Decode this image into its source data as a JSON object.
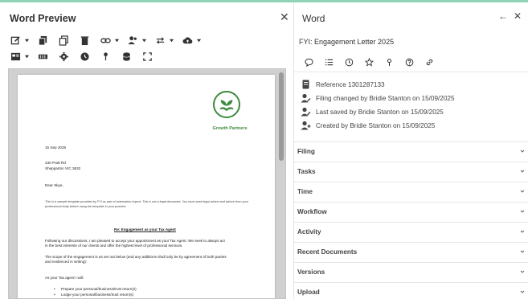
{
  "left": {
    "title": "Word Preview",
    "close": "✕"
  },
  "document": {
    "logo_text": "Growth Partners",
    "date": "15 Sep 2025",
    "address1": "430 Pratt Rd",
    "address2": "Shepparton VIC 3632",
    "salutation": "Dear Skye,",
    "italic1": "This is a sample template provided by FYI as part of automation import. This is not a legal document. You must seek legal advice and advice from your",
    "italic2": "professional body before using the template in your practice.",
    "heading": "Re: Engagement as your Tax Agent",
    "p1a": "Following our discussions, I am pleased to accept your appointment as your Tax Agent. We seek to always act",
    "p1b": "in the best interests of our clients and offer the highest level of professional services.",
    "p2a": "The scope of the engagement is as set out below (and any additions shall only be by agreement of both parties",
    "p2b": "and evidenced in writing):",
    "p3": "As your Tax agent I will:",
    "b1": "Prepare your personal/business/trust return(s)",
    "b2": "Lodge your personal/business/trust return(s)"
  },
  "right": {
    "title": "Word",
    "back": "←",
    "close": "✕",
    "subtitle": "FYI: Engagement Letter 2025",
    "meta": {
      "reference": "Reference 1301287133",
      "filing_changed": "Filing changed by Bridie Stanton on 15/09/2025",
      "last_saved": "Last saved by Bridie Stanton on 15/09/2025",
      "created": "Created by Bridie Stanton on 15/09/2025"
    },
    "sections": [
      "Filing",
      "Tasks",
      "Time",
      "Workflow",
      "Activity",
      "Recent Documents",
      "Versions",
      "Upload"
    ]
  },
  "colors": {
    "accent_line": "#8fd3b6",
    "logo_green": "#3c8a3c"
  }
}
